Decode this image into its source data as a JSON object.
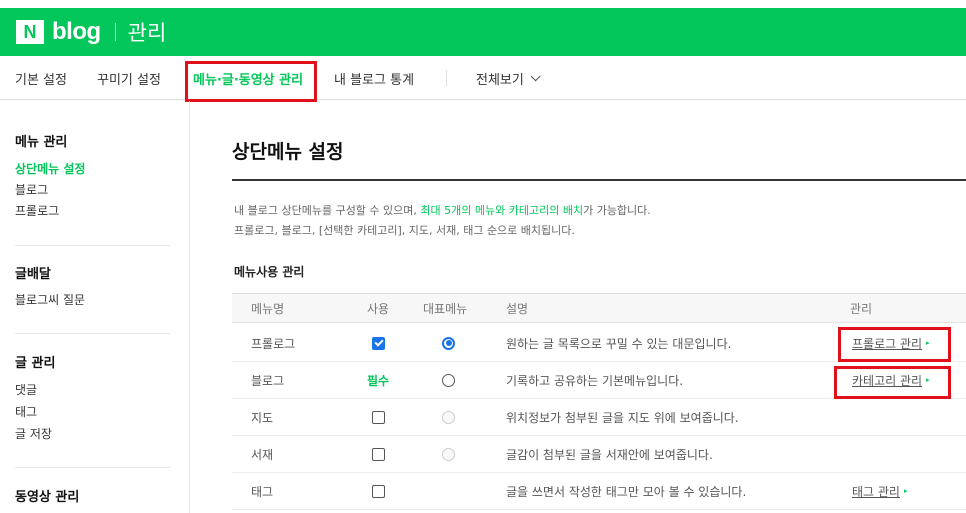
{
  "header": {
    "logo_n": "N",
    "logo_blog": "blog",
    "title": "관리"
  },
  "nav": {
    "items": [
      "기본 설정",
      "꾸미기 설정",
      "메뉴·글·동영상 관리",
      "내 블로그 통계"
    ],
    "view_all": "전체보기"
  },
  "sidebar": {
    "sections": [
      {
        "title": "메뉴 관리",
        "items": [
          "상단메뉴 설정",
          "블로그",
          "프롤로그"
        ]
      },
      {
        "title": "글배달",
        "items": [
          "블로그씨 질문"
        ]
      },
      {
        "title": "글 관리",
        "items": [
          "댓글",
          "태그",
          "글 저장"
        ]
      },
      {
        "title": "동영상 관리",
        "items": []
      }
    ]
  },
  "main": {
    "title": "상단메뉴 설정",
    "desc_line1_a": "내 블로그 상단메뉴를 구성할 수 있으며, ",
    "desc_line1_b": "최대 5개의 메뉴와 카테고리의 배치",
    "desc_line1_c": "가 가능합니다.",
    "desc_line2": "프롤로그, 블로그, [선택한 카테고리], 지도, 서재, 태그 순으로 배치됩니다.",
    "section_title": "메뉴사용 관리",
    "columns": [
      "메뉴명",
      "사용",
      "대표메뉴",
      "설명",
      "관리"
    ],
    "rows": [
      {
        "name": "프롤로그",
        "use": "checked",
        "rep": "checked",
        "desc": "원하는 글 목록으로 꾸밀 수 있는 대문입니다.",
        "link": "프롤로그 관리"
      },
      {
        "name": "블로그",
        "use_text": "필수",
        "rep": "unchecked",
        "desc": "기록하고 공유하는 기본메뉴입니다.",
        "link": "카테고리 관리"
      },
      {
        "name": "지도",
        "use": "unchecked",
        "rep": "disabled",
        "desc": "위치정보가 첨부된 글을 지도 위에 보여줍니다.",
        "link": ""
      },
      {
        "name": "서재",
        "use": "unchecked",
        "rep": "disabled",
        "desc": "글감이 첨부된 글을 서재안에 보여줍니다.",
        "link": ""
      },
      {
        "name": "태그",
        "use": "unchecked",
        "rep": "none",
        "desc": "글을 쓰면서 작성한 태그만 모아 볼 수 있습니다.",
        "link": "태그 관리"
      }
    ]
  },
  "colors": {
    "brand": "#03c75a",
    "highlight": "#e0111a",
    "control": "#1a73e8"
  }
}
